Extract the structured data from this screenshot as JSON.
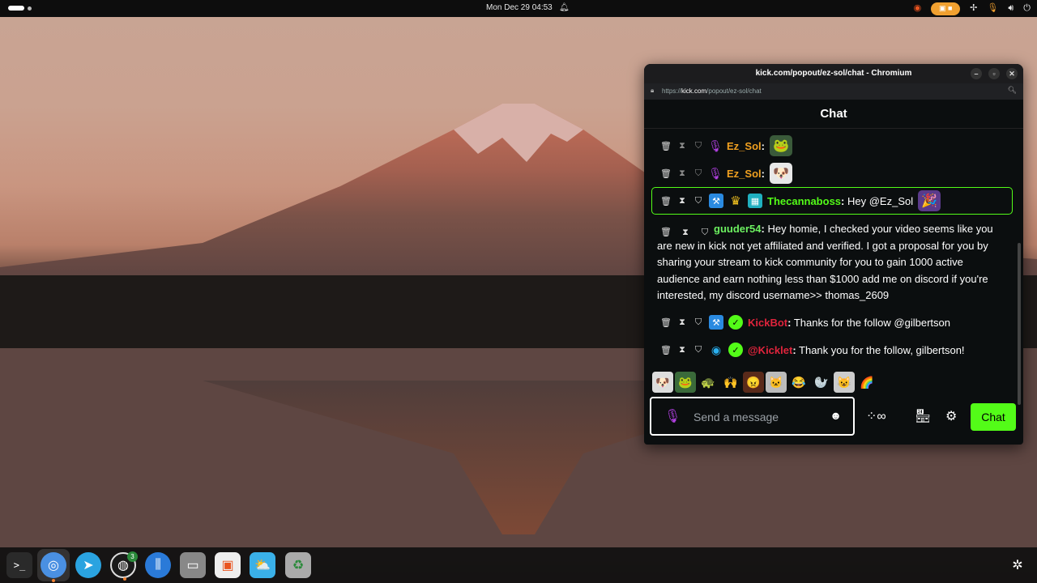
{
  "topbar": {
    "clock": "Mon Dec 29  04:53",
    "icons": [
      "bell-icon",
      "ubuntu-pro-icon",
      "recording-indicator",
      "pin-icon",
      "mic-icon",
      "volume-icon",
      "power-icon"
    ]
  },
  "dock": {
    "apps": [
      "terminal",
      "chromium",
      "telegram",
      "obs-studio",
      "mixer",
      "files",
      "app-center",
      "weather",
      "trash"
    ],
    "obs_badge": "3"
  },
  "window": {
    "title": "kick.com/popout/ez-sol/chat - Chromium",
    "url_prefix": "https://",
    "url_host": "kick.com",
    "url_path": "/popout/ez-sol/chat",
    "chat_header": "Chat"
  },
  "messages": [
    {
      "user": "Ez_Sol",
      "sep": ":",
      "text": "",
      "user_color": "#f0a020"
    },
    {
      "user": "Ez_Sol",
      "sep": ":",
      "text": "",
      "user_color": "#f0a020"
    },
    {
      "user": "Thecannaboss",
      "sep": ":",
      "text": " Hey @Ez_Sol",
      "user_color": "#53fc18"
    },
    {
      "user": "guuder54",
      "sep": ":",
      "text": " Hey homie, I checked your video seems like you are new in kick not yet affiliated and verified. I got a proposal for you by sharing your stream to kick community for you to gain 1000 active audience and earn nothing less than $1000 add me on discord if you're interested, my discord username>> thomas_2609",
      "user_color": "#6cf060"
    },
    {
      "user": "KickBot",
      "sep": ":",
      "text": " Thanks for the follow @gilbertson",
      "user_color": "#e0243c"
    },
    {
      "user": "@Kicklet",
      "sep": ":",
      "text": " Thank you for the follow, gilbertson!",
      "user_color": "#e0243c"
    }
  ],
  "input": {
    "placeholder": "Send a message",
    "send_label": "Chat"
  },
  "colors": {
    "accent": "#53fc18",
    "background": "#0b0e0f"
  }
}
